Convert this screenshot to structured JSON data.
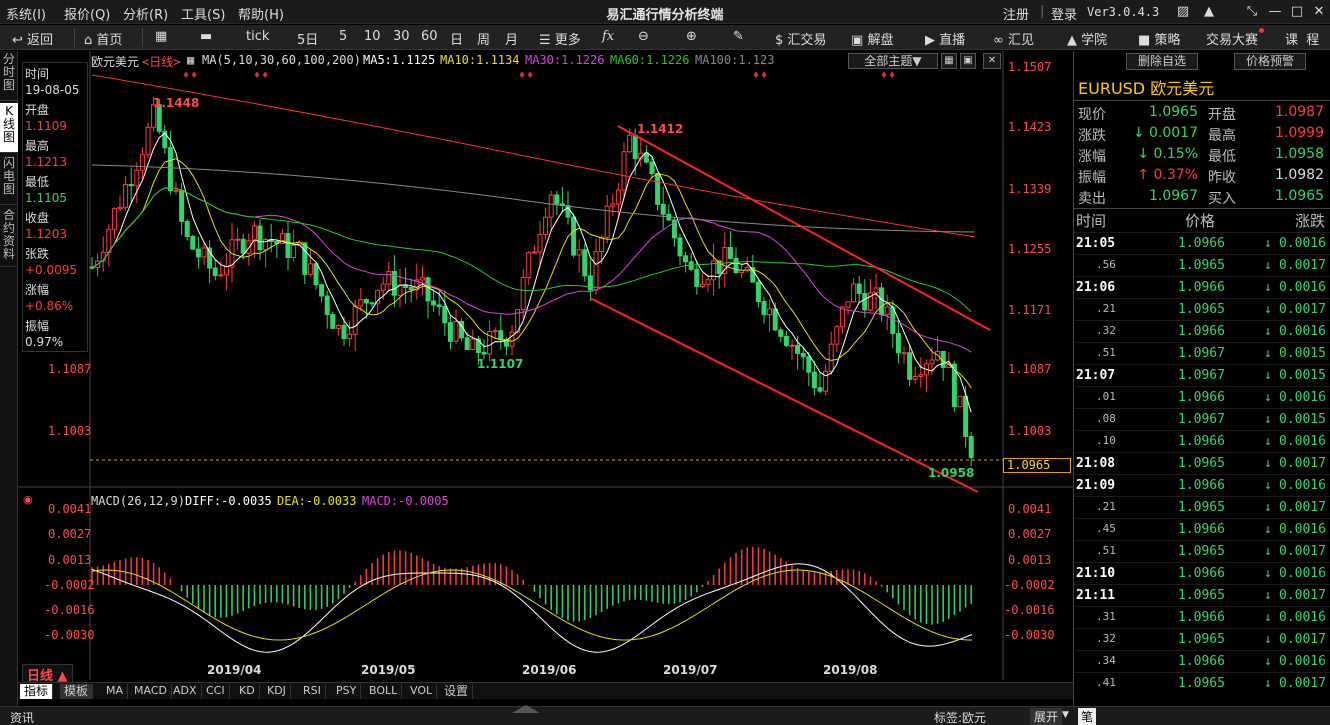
{
  "menu": {
    "items": [
      "系统(I)",
      "报价(Q)",
      "分析(R)",
      "工具(S)",
      "帮助(H)"
    ],
    "title": "易汇通行情分析终端",
    "login": "注册",
    "register": "登录",
    "version": "Ver3.0.4.3"
  },
  "toolbar": {
    "items": [
      "返回",
      "首页",
      "",
      "tick",
      "5日",
      "5",
      "10",
      "30",
      "60",
      "日",
      "周",
      "月",
      "更多",
      "fx",
      "",
      "",
      "",
      "汇交易",
      "解盘",
      "直播",
      "汇见",
      "学院",
      "策略",
      "交易大赛",
      "课",
      "程"
    ]
  },
  "left_tabs": [
    "分时图",
    "K线图",
    "闪电图",
    "合约资料"
  ],
  "info_panel": {
    "time_label": "时间",
    "date": "19-08-05",
    "open_label": "开盘",
    "open": "1.1109",
    "high_label": "最高",
    "high": "1.1213",
    "low_label": "最低",
    "low": "1.1105",
    "close_label": "收盘",
    "close": "1.1203",
    "chg_label": "张跌",
    "chg": "+0.0095",
    "pct_label": "涨幅",
    "pct": "+0.86%",
    "amp_label": "振幅",
    "amp": "0.97%"
  },
  "chart_header": {
    "symbol": "欧元美元",
    "period": "<日线>",
    "ma_label": "MA(5,10,30,60,100,200)",
    "ma5": "MA5:1.1125",
    "ma10": "MA10:1.1134",
    "ma30": "MA30:1.1226",
    "ma60": "MA60:1.1226",
    "ma100": "MA100:1.123",
    "theme_btn": "全部主题▼"
  },
  "right_buttons": {
    "remove": "删除自选",
    "alert": "价格预警"
  },
  "price_axis": [
    "1.1507",
    "1.1423",
    "1.1339",
    "1.1255",
    "1.1171",
    "1.1087",
    "1.1003"
  ],
  "price_axis_left": [
    "1.1087",
    "1.1003"
  ],
  "current_price_box": "1.0965",
  "annotations": {
    "high1": "1.1448",
    "low1": "1.1107",
    "high2": "1.1412",
    "low2": "1.0958"
  },
  "macd": {
    "header": "MACD(26,12,9)",
    "diff": "DIFF:-0.0035",
    "dea": "DEA:-0.0033",
    "macd": "MACD:-0.0005",
    "axis": [
      "0.0041",
      "0.0027",
      "0.0013",
      "-0.0002",
      "-0.0016",
      "-0.0030"
    ]
  },
  "date_axis": [
    "2019/04",
    "2019/05",
    "2019/06",
    "2019/07",
    "2019/08"
  ],
  "period_btn": "日线 ▲",
  "bottom_tabs": [
    "指标",
    "模板",
    "MA",
    "MACD",
    "ADX",
    "CCI",
    "KD",
    "KDJ",
    "RSI",
    "PSY",
    "BOLL",
    "VOL",
    "设置"
  ],
  "status_bar": {
    "news": "资讯",
    "tag": "标签:欧元",
    "expand": "展开",
    "ime": "笔"
  },
  "quote": {
    "code": "EURUSD",
    "name": "欧元美元",
    "rows": [
      {
        "l1": "现价",
        "v1": "1.0965",
        "l2": "开盘",
        "v2": "1.0987"
      },
      {
        "l1": "涨跌",
        "v1": "↓ 0.0017",
        "l2": "最高",
        "v2": "1.0999"
      },
      {
        "l1": "涨幅",
        "v1": "↓ 0.15%",
        "l2": "最低",
        "v2": "1.0958"
      },
      {
        "l1": "振幅",
        "v1": "↑ 0.37%",
        "l2": "昨收",
        "v2": "1.0982"
      },
      {
        "l1": "卖出",
        "v1": "1.0967",
        "l2": "买入",
        "v2": "1.0965"
      }
    ]
  },
  "ticks_header": {
    "time": "时间",
    "price": "价格",
    "change": "涨跌"
  },
  "ticks": [
    {
      "t": "21:05",
      "p": "1.0966",
      "c": "0.0016"
    },
    {
      "t": ".56",
      "p": "1.0965",
      "c": "0.0017"
    },
    {
      "t": "21:06",
      "p": "1.0966",
      "c": "0.0016"
    },
    {
      "t": ".21",
      "p": "1.0965",
      "c": "0.0017"
    },
    {
      "t": ".32",
      "p": "1.0966",
      "c": "0.0016"
    },
    {
      "t": ".51",
      "p": "1.0967",
      "c": "0.0015"
    },
    {
      "t": "21:07",
      "p": "1.0967",
      "c": "0.0015"
    },
    {
      "t": ".01",
      "p": "1.0966",
      "c": "0.0016"
    },
    {
      "t": ".08",
      "p": "1.0967",
      "c": "0.0015"
    },
    {
      "t": ".10",
      "p": "1.0966",
      "c": "0.0016"
    },
    {
      "t": "21:08",
      "p": "1.0965",
      "c": "0.0017"
    },
    {
      "t": "21:09",
      "p": "1.0966",
      "c": "0.0016"
    },
    {
      "t": ".21",
      "p": "1.0965",
      "c": "0.0017"
    },
    {
      "t": ".45",
      "p": "1.0966",
      "c": "0.0016"
    },
    {
      "t": ".51",
      "p": "1.0965",
      "c": "0.0017"
    },
    {
      "t": "21:10",
      "p": "1.0966",
      "c": "0.0016"
    },
    {
      "t": "21:11",
      "p": "1.0965",
      "c": "0.0017"
    },
    {
      "t": ".31",
      "p": "1.0966",
      "c": "0.0016"
    },
    {
      "t": ".32",
      "p": "1.0965",
      "c": "0.0017"
    },
    {
      "t": ".34",
      "p": "1.0966",
      "c": "0.0016"
    },
    {
      "t": ".41",
      "p": "1.0965",
      "c": "0.0017"
    }
  ],
  "colors": {
    "up": "#ff3b3b",
    "down": "#2fd66a",
    "ma5": "#ffffff",
    "ma10": "#e8e000",
    "ma30": "#e040e0",
    "ma60": "#22cc22",
    "ma100": "#888888",
    "ma200": "#ff3030",
    "channel": "#ff2020"
  }
}
